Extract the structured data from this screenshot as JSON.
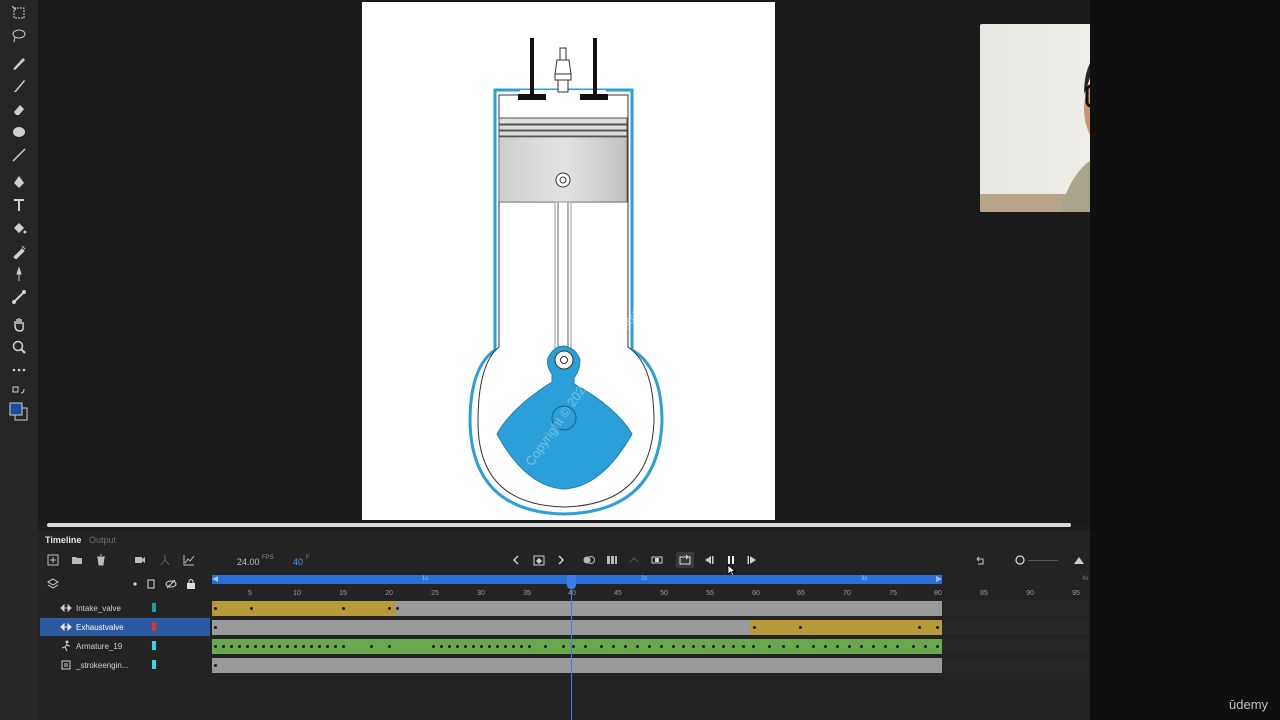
{
  "timeline": {
    "tabs": [
      "Timeline",
      "Output"
    ],
    "fps_value": "24.00",
    "fps_unit": "FPS",
    "current_frame": "40",
    "frame_unit": "F",
    "seconds_labels": [
      "1s",
      "2s",
      "3s",
      "4s"
    ],
    "frame_numbers": [
      "5",
      "10",
      "15",
      "20",
      "25",
      "30",
      "35",
      "40",
      "45",
      "50",
      "55",
      "60",
      "65",
      "70",
      "75",
      "80",
      "85",
      "90",
      "95"
    ],
    "layers": [
      {
        "name": "Intake_valve",
        "color": "#1aa39a",
        "selected": false
      },
      {
        "name": "Exhaustvalve",
        "color": "#e0302a",
        "selected": true
      },
      {
        "name": "Armature_19",
        "color": "#33d6e6",
        "selected": false
      },
      {
        "name": "_strokeengin...",
        "color": "#33d6e6",
        "selected": false
      }
    ]
  },
  "stage": {
    "watermark_text": "Copyright © 2025 - www.p30download.com"
  },
  "colors": {
    "accent_blue": "#2b6fd6",
    "tween_gold": "#b99a3a",
    "armature_green": "#6aa84f",
    "engine_blue": "#2a9fd8"
  },
  "branding": {
    "logo_text": "ūdemy"
  }
}
